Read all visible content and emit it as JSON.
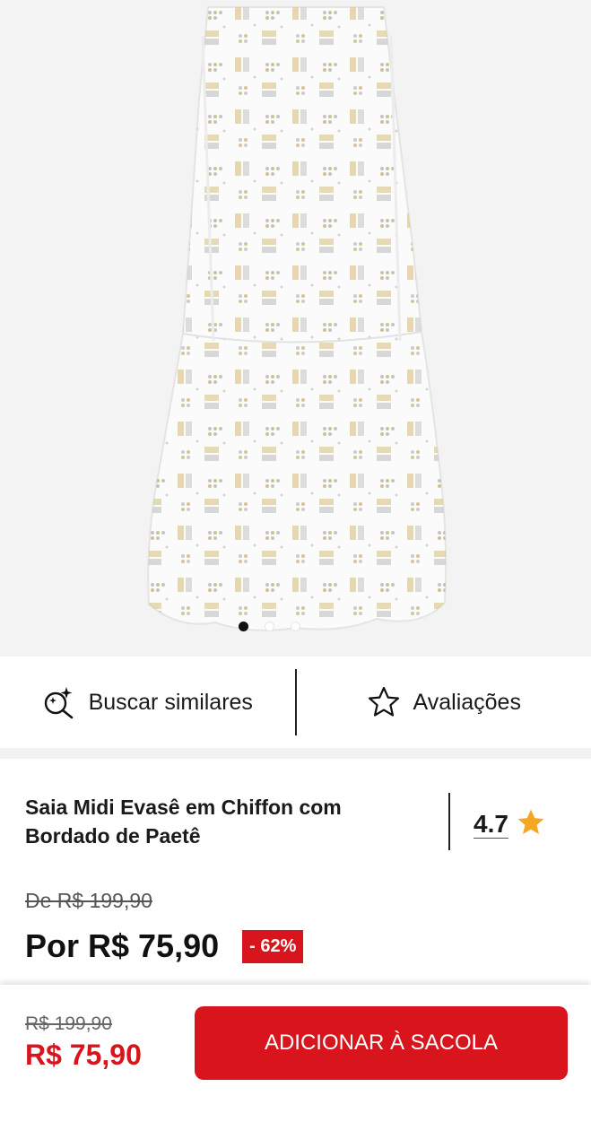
{
  "hero": {
    "image_alt": "white sequin chiffon midi skirt",
    "carousel": {
      "count": 3,
      "active_index": 0
    }
  },
  "actions": {
    "similar": {
      "label": "Buscar similares",
      "icon": "sparkle-search-icon"
    },
    "reviews": {
      "label": "Avaliações",
      "icon": "star-outline-icon"
    }
  },
  "product": {
    "title": "Saia Midi Evasê em Chiffon com Bordado de Paetê",
    "rating": "4.7",
    "rating_icon": "star-filled-icon",
    "old_price": "De R$ 199,90",
    "new_price": "Por R$ 75,90",
    "discount": "- 62%"
  },
  "bottom_bar": {
    "old_price": "R$ 199,90",
    "new_price": "R$ 75,90",
    "add_button": "ADICIONAR À SACOLA"
  },
  "colors": {
    "accent": "#d8141c",
    "star": "#f5a623",
    "background": "#f3f3f3"
  }
}
